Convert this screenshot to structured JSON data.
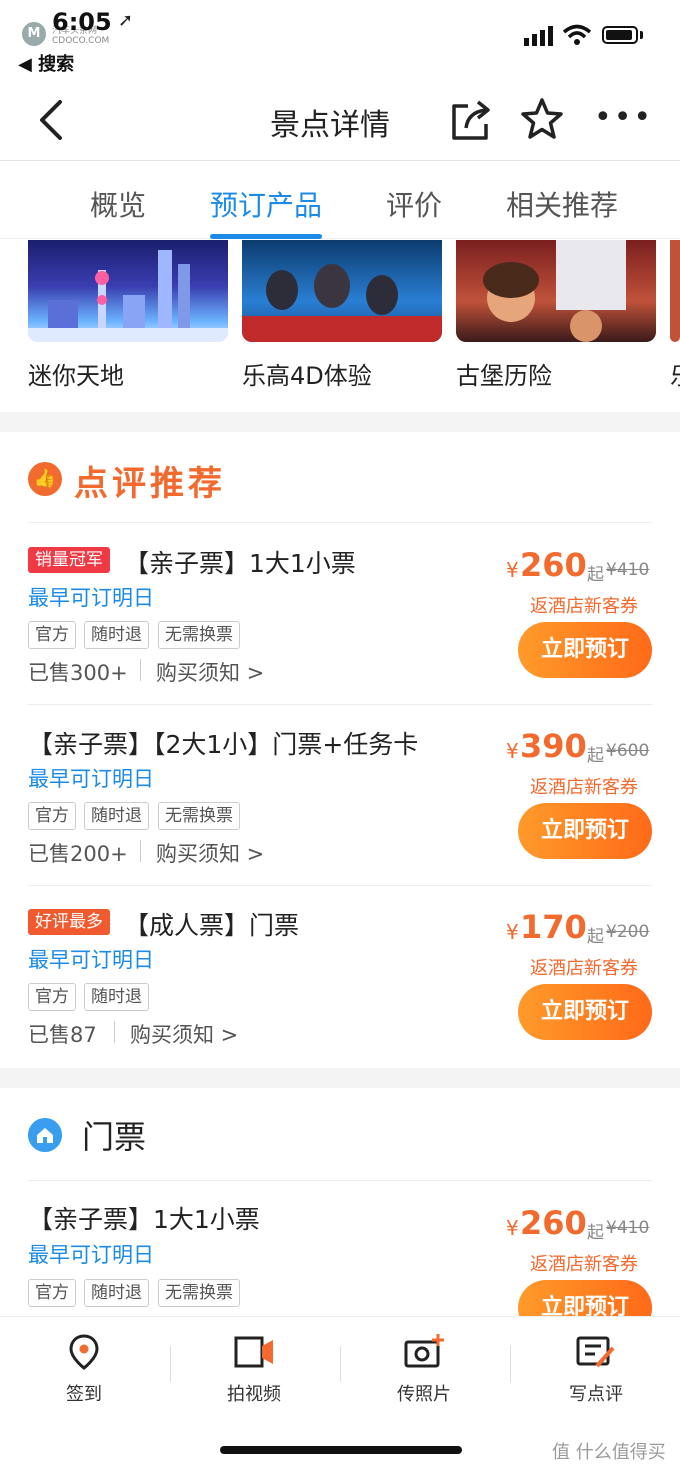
{
  "status": {
    "time": "6:05",
    "back_app": "◀ 搜索",
    "watermark_line1": "汽车头条网",
    "watermark_line2": "CDOCO.COM"
  },
  "nav": {
    "title": "景点详情"
  },
  "tabs": [
    {
      "label": "概览"
    },
    {
      "label": "预订产品"
    },
    {
      "label": "评价"
    },
    {
      "label": "相关推荐"
    }
  ],
  "thumbnails": [
    {
      "label": "迷你天地"
    },
    {
      "label": "乐高4D体验"
    },
    {
      "label": "古堡历险"
    },
    {
      "label": "乐"
    }
  ],
  "section_recommend": {
    "title": "点评推荐"
  },
  "products": [
    {
      "badge": "销量冠军",
      "name": "【亲子票】1大1小票",
      "book_date": "最早可订明日",
      "tags": [
        "官方",
        "随时退",
        "无需换票"
      ],
      "sold": "已售300+",
      "notice": "购买须知 >",
      "yen": "¥",
      "price": "260",
      "qi": "起",
      "orig": "¥410",
      "coupon": "返酒店新客券",
      "button": "立即预订"
    },
    {
      "name": "【亲子票】【2大1小】门票+任务卡",
      "book_date": "最早可订明日",
      "tags": [
        "官方",
        "随时退",
        "无需换票"
      ],
      "sold": "已售200+",
      "notice": "购买须知 >",
      "yen": "¥",
      "price": "390",
      "qi": "起",
      "orig": "¥600",
      "coupon": "返酒店新客券",
      "button": "立即预订"
    },
    {
      "badge": "好评最多",
      "name": "【成人票】门票",
      "book_date": "最早可订明日",
      "tags": [
        "官方",
        "随时退"
      ],
      "sold": "已售87",
      "notice": "购买须知 >",
      "yen": "¥",
      "price": "170",
      "qi": "起",
      "orig": "¥200",
      "coupon": "返酒店新客券",
      "button": "立即预订"
    }
  ],
  "section_tickets": {
    "title": "门票"
  },
  "ticket_product": {
    "name": "【亲子票】1大1小票",
    "book_date": "最早可订明日",
    "tags": [
      "官方",
      "随时退",
      "无需换票"
    ],
    "yen": "¥",
    "price": "260",
    "qi": "起",
    "orig": "¥410",
    "coupon": "返酒店新客券",
    "button": "立即预订"
  },
  "bottom_bar": [
    {
      "label": "签到",
      "icon": "location-pin-icon"
    },
    {
      "label": "拍视频",
      "icon": "video-camera-icon"
    },
    {
      "label": "传照片",
      "icon": "add-photo-icon"
    },
    {
      "label": "写点评",
      "icon": "write-review-icon"
    }
  ],
  "bottom_watermark": "值 什么值得买",
  "colors": {
    "accent": "#1c8be8",
    "orange": "#f26a2e",
    "badge_red": "#ef3a45"
  }
}
